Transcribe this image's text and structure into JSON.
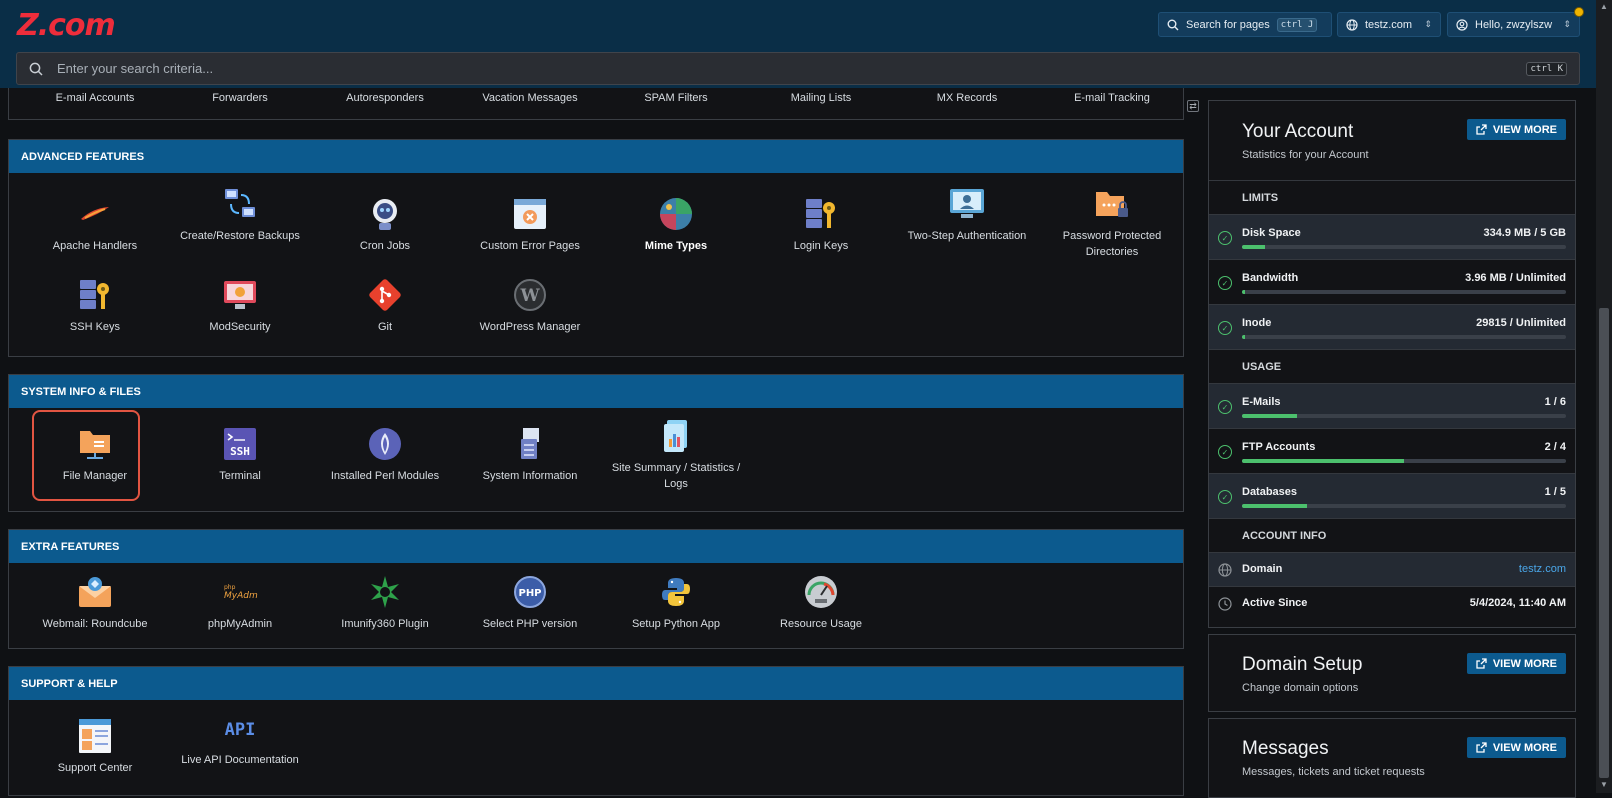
{
  "header": {
    "logo": "Z.com",
    "search_pages": {
      "label": "Search for pages",
      "shortcut": "ctrl J"
    },
    "domain_select": "testz.com",
    "user_menu": "Hello, zwzylszw"
  },
  "search": {
    "placeholder": "Enter your search criteria...",
    "shortcut": "ctrl K"
  },
  "email_row": [
    "E-mail Accounts",
    "Forwarders",
    "Autoresponders",
    "Vacation Messages",
    "SPAM Filters",
    "Mailing Lists",
    "MX Records",
    "E-mail Tracking"
  ],
  "advanced": {
    "title": "ADVANCED FEATURES",
    "items": [
      "Apache Handlers",
      "Create/Restore Backups",
      "Cron Jobs",
      "Custom Error Pages",
      "Mime Types",
      "Login Keys",
      "Two-Step Authentication",
      "Password Protected Directories",
      "SSH Keys",
      "ModSecurity",
      "Git",
      "WordPress Manager"
    ]
  },
  "system": {
    "title": "SYSTEM INFO & FILES",
    "items": [
      "File Manager",
      "Terminal",
      "Installed Perl Modules",
      "System Information",
      "Site Summary / Statistics / Logs"
    ]
  },
  "extra": {
    "title": "EXTRA FEATURES",
    "items": [
      "Webmail: Roundcube",
      "phpMyAdmin",
      "Imunify360 Plugin",
      "Select PHP version",
      "Setup Python App",
      "Resource Usage"
    ]
  },
  "support": {
    "title": "SUPPORT & HELP",
    "items": [
      "Support Center",
      "Live API Documentation"
    ]
  },
  "account": {
    "title": "Your Account",
    "subtitle": "Statistics for your Account",
    "view_more": "VIEW MORE",
    "limits_label": "LIMITS",
    "limits": [
      {
        "name": "Disk Space",
        "value": "334.9 MB / 5 GB",
        "fraction": 0.07
      },
      {
        "name": "Bandwidth",
        "value": "3.96 MB / Unlimited",
        "fraction": 0.01
      },
      {
        "name": "Inode",
        "value": "29815 / Unlimited",
        "fraction": 0.01
      }
    ],
    "usage_label": "USAGE",
    "usage": [
      {
        "name": "E-Mails",
        "value": "1 / 6",
        "fraction": 0.17
      },
      {
        "name": "FTP Accounts",
        "value": "2 / 4",
        "fraction": 0.5
      },
      {
        "name": "Databases",
        "value": "1 / 5",
        "fraction": 0.2
      }
    ],
    "info_label": "ACCOUNT INFO",
    "domain_label": "Domain",
    "domain_value": "testz.com",
    "active_label": "Active Since",
    "active_value": "5/4/2024, 11:40 AM"
  },
  "domain_setup": {
    "title": "Domain Setup",
    "subtitle": "Change domain options",
    "view_more": "VIEW MORE"
  },
  "messages": {
    "title": "Messages",
    "subtitle": "Messages, tickets and ticket requests",
    "view_more": "VIEW MORE"
  },
  "colors": {
    "header_bg": "#0a2e47",
    "section_head": "#0c5a8e",
    "accent_green": "#4cc06d",
    "highlight": "#e25542",
    "logo": "#ee2d3b"
  }
}
